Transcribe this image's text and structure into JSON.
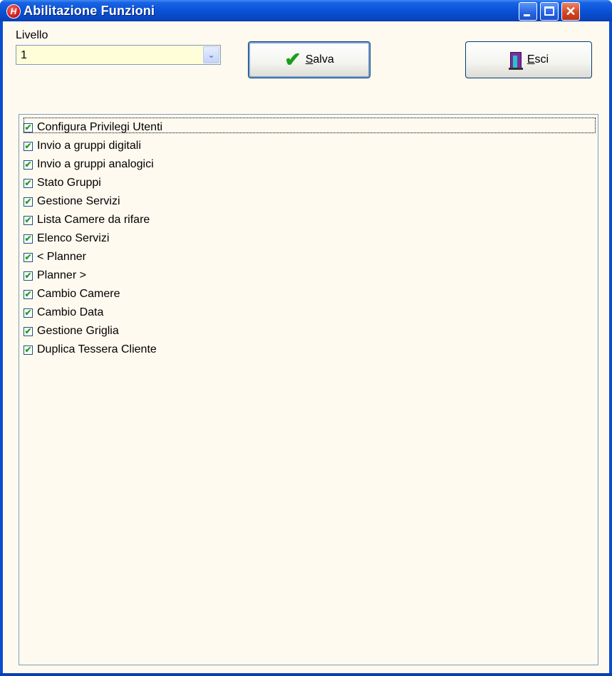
{
  "window": {
    "title": "Abilitazione Funzioni",
    "app_icon_glyph": "H",
    "close_glyph": "✕"
  },
  "level": {
    "label": "Livello",
    "value": "1",
    "dropdown_glyph": "⌄"
  },
  "toolbar": {
    "save_label": "Salva",
    "save_mnemonic": "S",
    "save_rest": "alva",
    "exit_label": "Esci",
    "exit_mnemonic": "E",
    "exit_rest": "sci",
    "save_icon": "check-icon",
    "exit_icon": "door-icon"
  },
  "functions": {
    "items": [
      {
        "label": "Configura Privilegi Utenti",
        "checked": true
      },
      {
        "label": "Invio a gruppi digitali",
        "checked": true
      },
      {
        "label": "Invio a gruppi analogici",
        "checked": true
      },
      {
        "label": "Stato Gruppi",
        "checked": true
      },
      {
        "label": "Gestione Servizi",
        "checked": true
      },
      {
        "label": "Lista Camere da rifare",
        "checked": true
      },
      {
        "label": "Elenco Servizi",
        "checked": true
      },
      {
        "label": "< Planner",
        "checked": true
      },
      {
        "label": "Planner >",
        "checked": true
      },
      {
        "label": "Cambio Camere",
        "checked": true
      },
      {
        "label": "Cambio Data",
        "checked": true
      },
      {
        "label": "Gestione Griglia",
        "checked": true
      },
      {
        "label": "Duplica Tessera Cliente",
        "checked": true
      }
    ]
  },
  "colors": {
    "titlebar": "#0a55d9",
    "client_bg": "#fffaf0",
    "combo_bg": "#fffed9",
    "check_green": "#21a121"
  }
}
